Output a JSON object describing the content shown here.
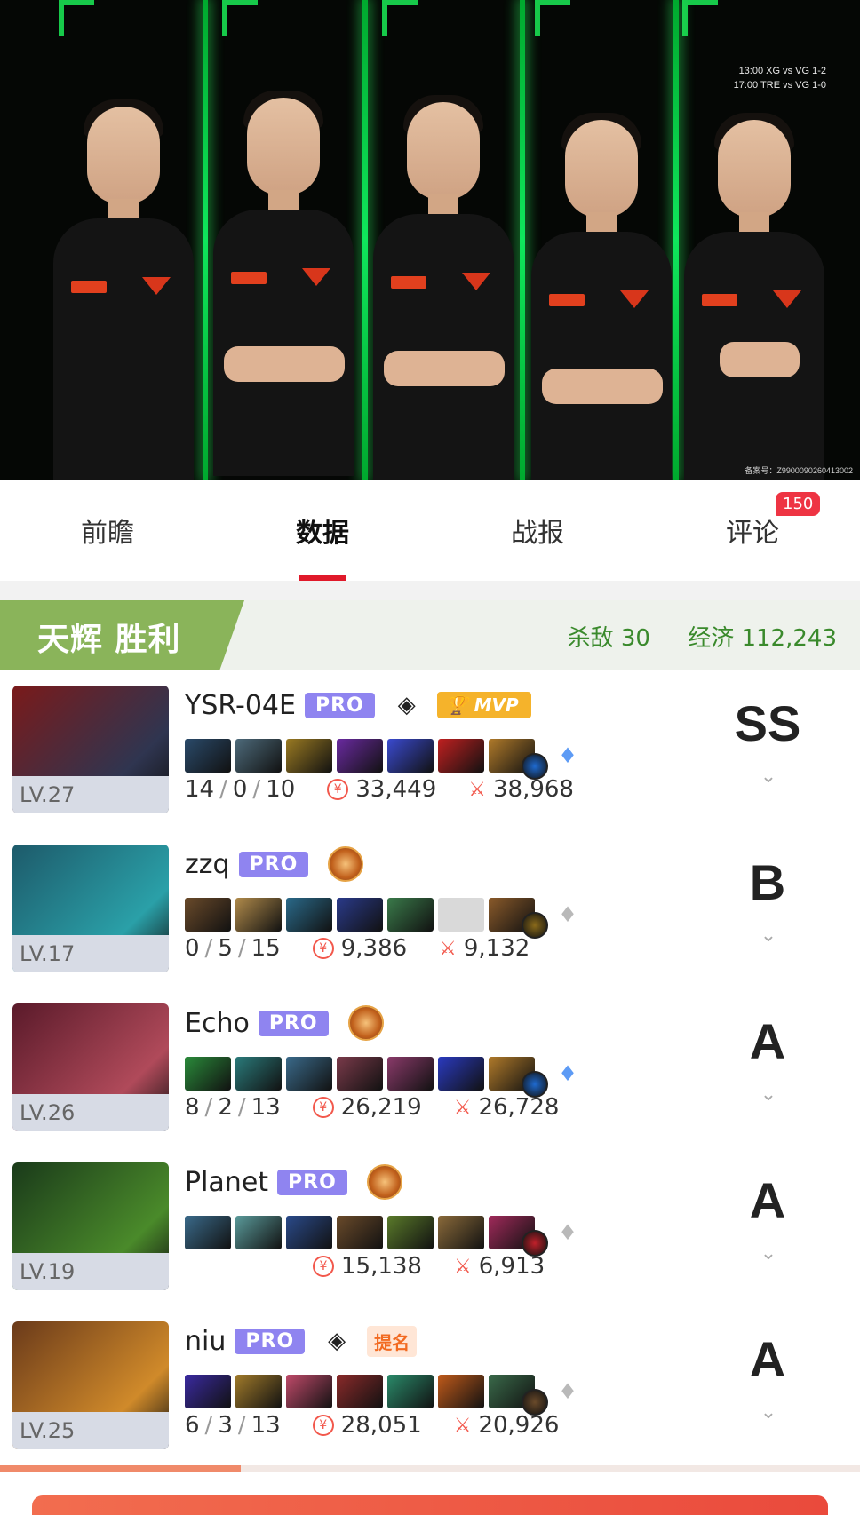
{
  "banner": {
    "schedule": [
      "13:00 XG vs VG 1-2",
      "17:00 TRE vs VG 1-0"
    ],
    "registration": "备案号：Z9900090260413002"
  },
  "tabs": [
    {
      "label": "前瞻"
    },
    {
      "label": "数据",
      "active": true
    },
    {
      "label": "战报"
    },
    {
      "label": "评论",
      "badge": "150"
    }
  ],
  "team": {
    "title": "天辉 胜利",
    "kills_label": "杀敌 30",
    "economy_label": "经济 112,243"
  },
  "players": [
    {
      "name": "YSR-04E",
      "pro": "PRO",
      "level": "LV.27",
      "k": "14",
      "d": "0",
      "a": "10",
      "gold": "33,449",
      "damage": "38,968",
      "grade": "SS",
      "badges": [
        "rank-icon",
        "MVP"
      ],
      "hero_colors": [
        "#7a1a1a",
        "#2f3550"
      ],
      "items": [
        "#2a4a6a",
        "#4d6a7a",
        "#9a7a22",
        "#6a2aa0",
        "#3a4ad0",
        "#c02020",
        "#b07a2a"
      ],
      "neutral": "#1e6ad0",
      "aghs": "blue"
    },
    {
      "name": "zzq",
      "pro": "PRO",
      "level": "LV.17",
      "k": "0",
      "d": "5",
      "a": "15",
      "gold": "9,386",
      "damage": "9,132",
      "grade": "B",
      "badges": [
        "crest"
      ],
      "hero_colors": [
        "#1d5a6a",
        "#2aa0a8"
      ],
      "items": [
        "#6a4a2a",
        "#b08a4a",
        "#2a6a8a",
        "#2a3a8a",
        "#3a7a4a",
        "",
        "#8a5a2a"
      ],
      "neutral": "#8a6a1a",
      "aghs": "grey"
    },
    {
      "name": "Echo",
      "pro": "PRO",
      "level": "LV.26",
      "k": "8",
      "d": "2",
      "a": "13",
      "gold": "26,219",
      "damage": "26,728",
      "grade": "A",
      "badges": [
        "crest"
      ],
      "hero_colors": [
        "#5a1a2a",
        "#b04a5a"
      ],
      "items": [
        "#2a8a3a",
        "#2a7a7a",
        "#3a6a8a",
        "#7a3a4a",
        "#8a3a6a",
        "#2a3ac0",
        "#b07a2a"
      ],
      "neutral": "#1e6ad0",
      "aghs": "blue"
    },
    {
      "name": "Planet",
      "pro": "PRO",
      "level": "LV.19",
      "k": "",
      "d": "",
      "a": "",
      "gold": "15,138",
      "damage": "6,913",
      "grade": "A",
      "badges": [
        "crest"
      ],
      "hero_colors": [
        "#1a3a1a",
        "#4a8a2a"
      ],
      "items": [
        "#3a6a8a",
        "#5a9a9a",
        "#2a4a8a",
        "#6a4a2a",
        "#5a7a2a",
        "#8a6a3a",
        "#a02a5a"
      ],
      "neutral": "#c0202a",
      "aghs": "grey"
    },
    {
      "name": "niu",
      "pro": "PRO",
      "level": "LV.25",
      "k": "6",
      "d": "3",
      "a": "13",
      "gold": "28,051",
      "damage": "20,926",
      "grade": "A",
      "badges": [
        "rank-icon",
        "提名"
      ],
      "hero_colors": [
        "#6a3a1a",
        "#d08a2a"
      ],
      "items": [
        "#3a2aa0",
        "#a07a2a",
        "#c04a6a",
        "#8a2a2a",
        "#2a8a6a",
        "#c05a1a",
        "#3a6a4a"
      ],
      "neutral": "#6a4a2a",
      "aghs": "grey"
    }
  ],
  "progress_fraction": 0.28
}
